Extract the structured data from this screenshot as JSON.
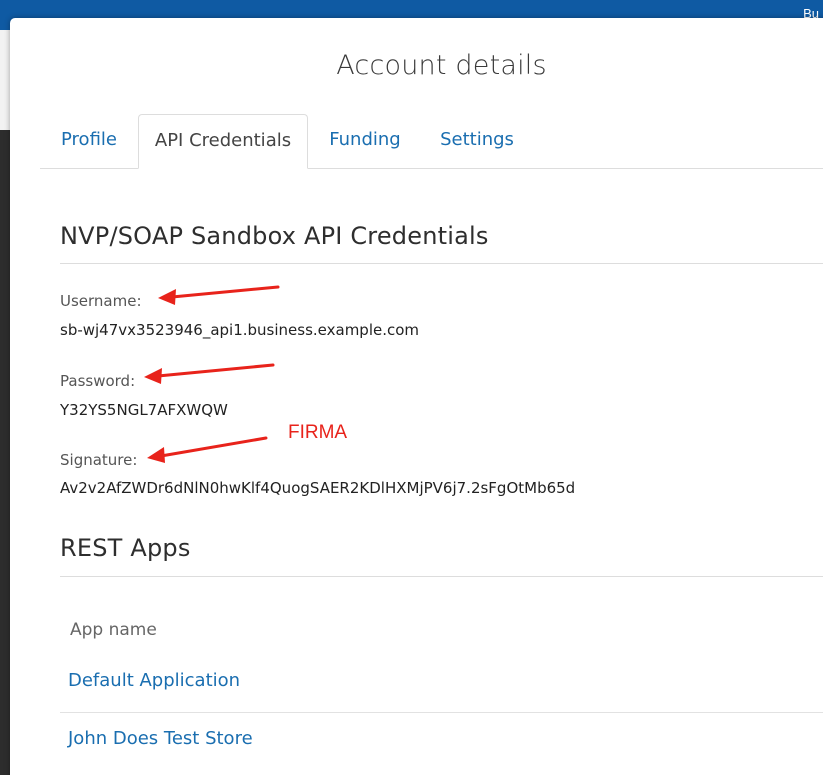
{
  "background": {
    "topbar_text": "Bu"
  },
  "modal": {
    "title": "Account details"
  },
  "tabs": [
    {
      "label": "Profile",
      "active": false
    },
    {
      "label": "API Credentials",
      "active": true
    },
    {
      "label": "Funding",
      "active": false
    },
    {
      "label": "Settings",
      "active": false
    }
  ],
  "nvp": {
    "heading": "NVP/SOAP Sandbox API Credentials",
    "fields": [
      {
        "label": "Username:",
        "value": "sb-wj47vx3523946_api1.business.example.com"
      },
      {
        "label": "Password:",
        "value": "Y32YS5NGL7AFXWQW"
      },
      {
        "label": "Signature:",
        "value": "Av2v2AfZWDr6dNlN0hwKlf4QuogSAER2KDlHXMjPV6j7.2sFgOtMb65d"
      }
    ]
  },
  "annotation": {
    "text": "FIRMA",
    "color": "#e8231b"
  },
  "rest": {
    "heading": "REST Apps",
    "column_header": "App name",
    "apps": [
      {
        "name": "Default Application"
      },
      {
        "name": "John Does Test Store"
      }
    ]
  },
  "colors": {
    "link": "#1a6eb0",
    "brand_bar": "#0f5aa3"
  }
}
